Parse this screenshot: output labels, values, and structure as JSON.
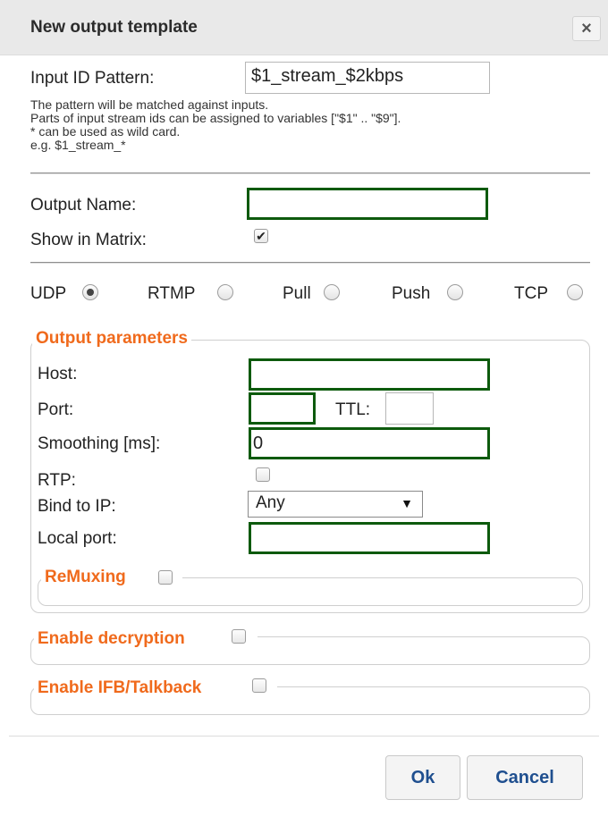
{
  "dialog": {
    "title": "New output template",
    "close_icon": "×"
  },
  "input_id": {
    "label": "Input ID Pattern:",
    "value": "$1_stream_$2kbps",
    "help": [
      "The pattern will be matched against inputs.",
      "Parts of input stream ids can be assigned to variables [\"$1\" .. \"$9\"].",
      "* can be used as wild card.",
      "e.g. $1_stream_*"
    ]
  },
  "output_name": {
    "label": "Output Name:",
    "value": ""
  },
  "show_in_matrix": {
    "label": "Show in Matrix:",
    "checked": true,
    "check_glyph": "✔"
  },
  "protocols": [
    {
      "label": "UDP",
      "selected": true
    },
    {
      "label": "RTMP",
      "selected": false
    },
    {
      "label": "Pull",
      "selected": false
    },
    {
      "label": "Push",
      "selected": false
    },
    {
      "label": "TCP",
      "selected": false
    }
  ],
  "output_parameters": {
    "legend": "Output parameters",
    "host": {
      "label": "Host:",
      "value": ""
    },
    "port": {
      "label": "Port:",
      "value": ""
    },
    "ttl": {
      "label": "TTL:",
      "value": ""
    },
    "smoothing": {
      "label": "Smoothing [ms]:",
      "value": "0"
    },
    "rtp": {
      "label": "RTP:",
      "checked": false
    },
    "bind_ip": {
      "label": "Bind to IP:",
      "value": "Any",
      "arrow": "▼"
    },
    "local_port": {
      "label": "Local port:",
      "value": ""
    },
    "remuxing": {
      "legend": "ReMuxing",
      "checked": false
    }
  },
  "enable_decryption": {
    "legend": "Enable decryption",
    "checked": false
  },
  "enable_ifb": {
    "legend": "Enable IFB/Talkback",
    "checked": false
  },
  "buttons": {
    "ok": "Ok",
    "cancel": "Cancel"
  },
  "colors": {
    "accent_orange": "#f06a1c",
    "required_green": "#0d5a0d",
    "button_text": "#1f4f8f"
  }
}
